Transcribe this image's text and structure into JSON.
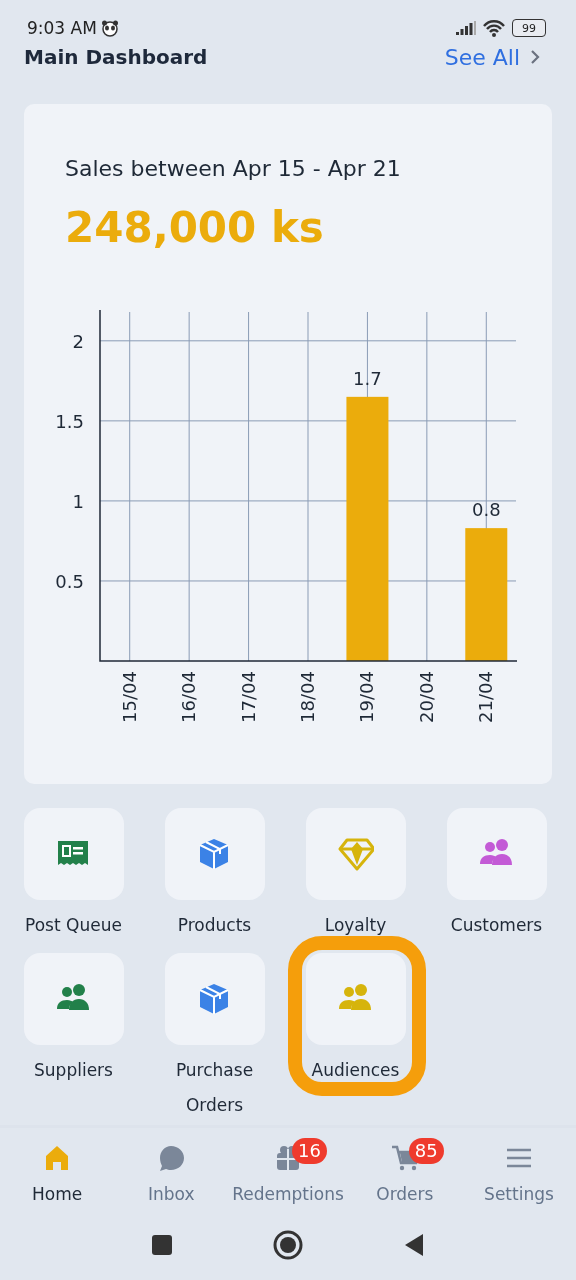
{
  "status_bar": {
    "time": "9:03 AM",
    "battery": "99"
  },
  "header": {
    "title": "Main Dashboard",
    "link": "See All"
  },
  "sales_card": {
    "title": "Sales between Apr 15 - Apr 21",
    "amount": "248,000 ks",
    "chart_data": {
      "type": "bar",
      "categories": [
        "15/04",
        "16/04",
        "17/04",
        "18/04",
        "19/04",
        "20/04",
        "21/04"
      ],
      "grid": true,
      "series": [
        {
          "color": "#ebac0c",
          "values": [
            null,
            null,
            null,
            null,
            1.65,
            null,
            0.83
          ]
        }
      ],
      "ylim": [
        0,
        2.18
      ],
      "yticks": [
        0.5,
        1,
        1.5,
        2
      ],
      "value_labels": [
        null,
        null,
        null,
        null,
        "1.7",
        null,
        "0.8"
      ]
    }
  },
  "shortcuts": [
    {
      "label": "Post Queue",
      "kind": "receipt",
      "color": "#22804a",
      "highlighted": false
    },
    {
      "label": "Products",
      "kind": "box",
      "color": "#3b82e6",
      "highlighted": false
    },
    {
      "label": "Loyalty",
      "kind": "diamond",
      "color": "#d6b40c",
      "highlighted": false
    },
    {
      "label": "Customers",
      "kind": "people",
      "color": "#c35ad6",
      "highlighted": false
    },
    {
      "label": "Suppliers",
      "kind": "people",
      "color": "#22804a",
      "highlighted": false
    },
    {
      "label": "Purchase Orders",
      "kind": "box",
      "color": "#3b82e6",
      "highlighted": false
    },
    {
      "label": "Audiences",
      "kind": "people",
      "color": "#d6b40c",
      "highlighted": true
    }
  ],
  "bottom_nav": [
    {
      "label": "Home",
      "kind": "home",
      "selected": true
    },
    {
      "label": "Inbox",
      "kind": "chat",
      "selected": false
    },
    {
      "label": "Redemptions",
      "kind": "gift",
      "selected": false,
      "badge": "16"
    },
    {
      "label": "Orders",
      "kind": "cart",
      "selected": false,
      "badge": "85"
    },
    {
      "label": "Settings",
      "kind": "menu",
      "selected": false
    }
  ]
}
